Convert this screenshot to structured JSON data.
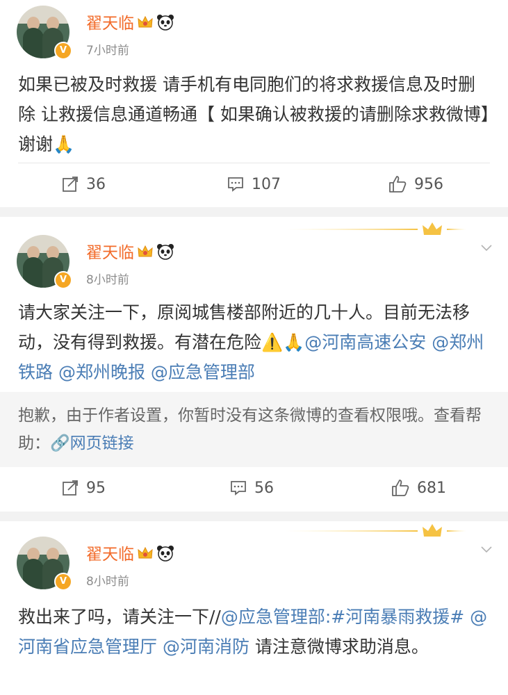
{
  "posts": [
    {
      "author": "翟天临",
      "time": "7小时前",
      "content": "如果已被及时救援 请手机有电同胞们的将求救援信息及时删除 让救援信息通道畅通【  如果确认被救援的请删除求救微博】谢谢🙏",
      "repost": "36",
      "comment": "107",
      "like": "956"
    },
    {
      "author": "翟天临",
      "time": "8小时前",
      "content_text": "请大家关注一下，原阅城售楼部附近的几十人。目前无法移动，没有得到救援。有潜在危险⚠️🙏",
      "mentions": [
        "@河南",
        "高速公安 @郑州铁路 @郑州晚报 @应急管理部"
      ],
      "notice_text": "抱歉，由于作者设置，你暂时没有这条微博的查看权限哦。查看帮助：",
      "notice_link": "网页链接",
      "repost": "95",
      "comment": "56",
      "like": "681"
    },
    {
      "author": "翟天临",
      "time": "8小时前",
      "content_prefix": "救出来了吗，请关注一下//",
      "mention_links": "@应急管理部:#河南暴雨救援# @河南省应急管理厅 @河南消防",
      "content_suffix": " 请注意微博求助消息。"
    }
  ],
  "colors": {
    "name": "#f26b2a",
    "link": "#4a7db5",
    "badge": "#f5a623"
  },
  "icons": [
    "repost-icon",
    "comment-icon",
    "like-icon",
    "crown-icon",
    "panda-icon",
    "verified-badge-icon",
    "chevron-down-icon"
  ]
}
